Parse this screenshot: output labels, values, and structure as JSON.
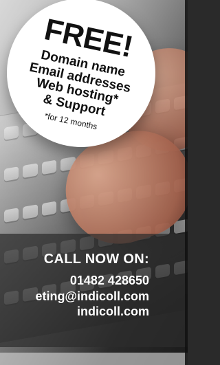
{
  "badge": {
    "headline": "FREE!",
    "lines": [
      "Domain name",
      "Email addresses",
      "Web hosting*",
      "& Support"
    ],
    "note": "*for 12 months"
  },
  "contact": {
    "call_label": "CALL NOW ON:",
    "phone": "01482 428650",
    "email_visible": "eting@indicoll.com",
    "website": "indicoll.com"
  }
}
